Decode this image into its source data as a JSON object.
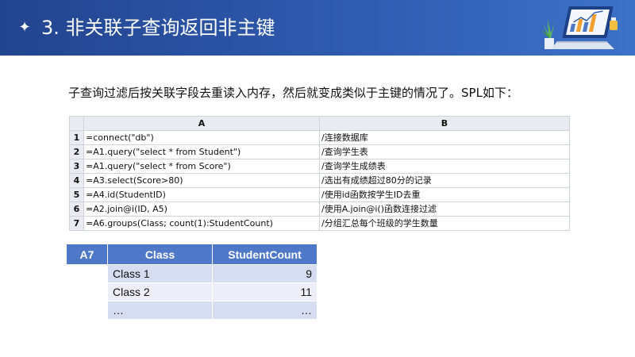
{
  "header": {
    "star": "✦",
    "title": "3. 非关联子查询返回非主键"
  },
  "intro": "子查询过滤后按关联字段去重读入内存，然后就变成类似于主键的情况了。SPL如下：",
  "grid": {
    "columns": [
      "A",
      "B"
    ],
    "rows": [
      {
        "n": "1",
        "a": "=connect(\"db\")",
        "b": "/连接数据库"
      },
      {
        "n": "2",
        "a": "=A1.query(\"select * from Student\")",
        "b": "/查询学生表"
      },
      {
        "n": "3",
        "a": "=A1.query(\"select * from Score\")",
        "b": "/查询学生成绩表"
      },
      {
        "n": "4",
        "a": "=A3.select(Score>80)",
        "b": "/选出有成绩超过80分的记录"
      },
      {
        "n": "5",
        "a": "=A4.id(StudentID)",
        "b": "/使用id函数按学生ID去重"
      },
      {
        "n": "6",
        "a": "=A2.join@i(ID, A5)",
        "b": "/使用A.join@i()函数连接过滤"
      },
      {
        "n": "7",
        "a": "=A6.groups(Class; count(1):StudentCount)",
        "b": "/分组汇总每个班级的学生数量"
      }
    ]
  },
  "result": {
    "cell": "A7",
    "headers": [
      "Class",
      "StudentCount"
    ],
    "rows": [
      {
        "class": "Class 1",
        "count": "9"
      },
      {
        "class": "Class 2",
        "count": "11"
      },
      {
        "class": "…",
        "count": "…"
      }
    ]
  },
  "colors": {
    "header_dark": "#23448f",
    "header_light": "#3d72c8",
    "result_header": "#4f78c8",
    "result_row": "#d6ddf0"
  }
}
